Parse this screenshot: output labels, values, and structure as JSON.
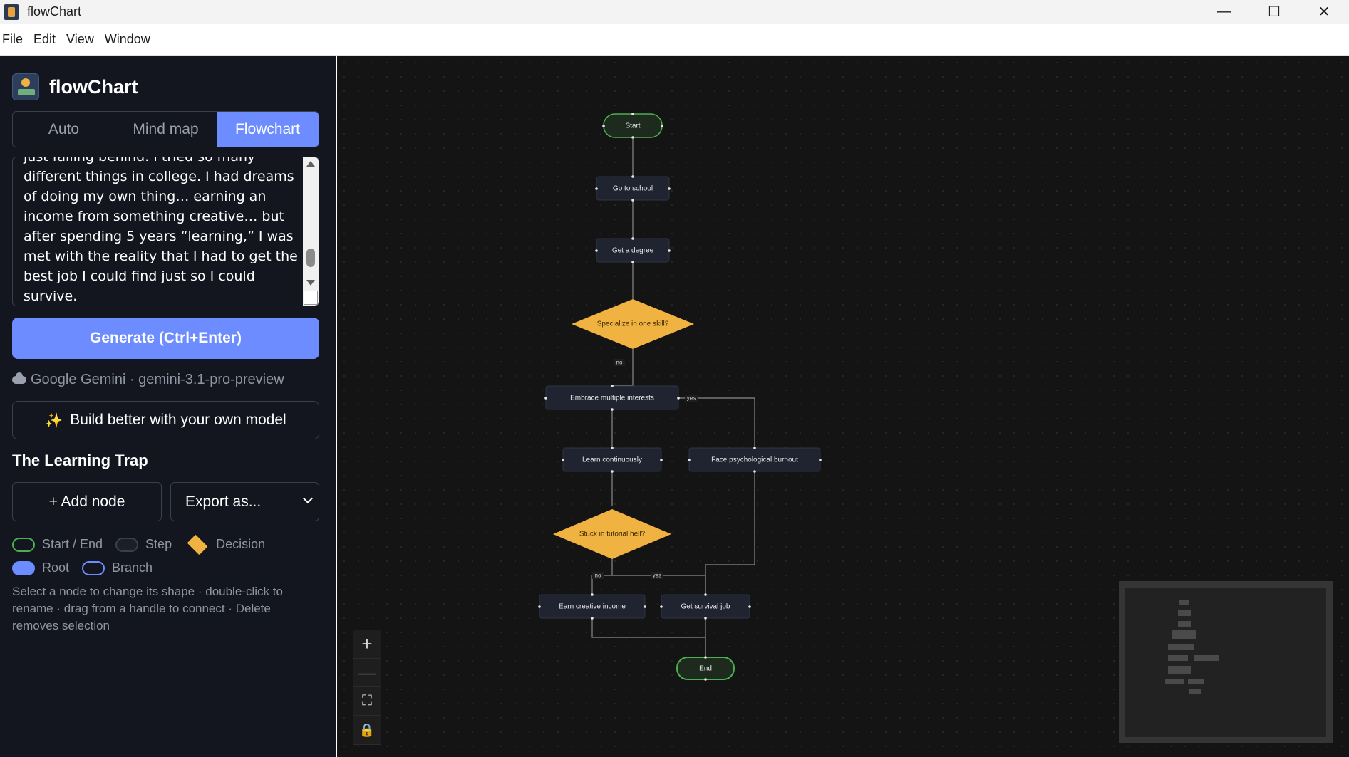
{
  "window": {
    "title": "flowChart",
    "minimize_glyph": "—",
    "maximize_glyph": "☐",
    "close_glyph": "✕"
  },
  "menu": [
    "File",
    "Edit",
    "View",
    "Window"
  ],
  "sidebar": {
    "brand": "flowChart",
    "tabs": [
      {
        "label": "Auto",
        "active": false
      },
      {
        "label": "Mind map",
        "active": false
      },
      {
        "label": "Flowchart",
        "active": true
      }
    ],
    "prompt_text": "just falling behind. I tried so many different things in college. I had dreams of doing my own thing… earning an income from something creative… but after spending 5 years “learning,” I was met with the reality that I had to get the best job I could find just so I could survive.",
    "generate_label": "Generate (Ctrl+Enter)",
    "provider": "Google Gemini · gemini-3.1-pro-preview",
    "build_label": "Build better with your own model",
    "doc_title": "The Learning Trap",
    "add_node_label": "+ Add node",
    "export_label": "Export as...",
    "legend": {
      "start_end": "Start / End",
      "step": "Step",
      "decision": "Decision",
      "root": "Root",
      "branch": "Branch"
    },
    "hint": "Select a node to change its shape · double-click to rename · drag from a handle to connect · Delete removes selection"
  },
  "colors": {
    "accent": "#6c8cff",
    "decision": "#f0b240",
    "start_end_border": "#4caf50",
    "canvas_bg": "#141414",
    "sidebar_bg": "#13161f"
  },
  "flowchart": {
    "nodes": [
      {
        "id": "start",
        "label": "Start",
        "shape": "start-end"
      },
      {
        "id": "school",
        "label": "Go to school",
        "shape": "step"
      },
      {
        "id": "degree",
        "label": "Get a degree",
        "shape": "step"
      },
      {
        "id": "specialize",
        "label": "Specialize in one skill?",
        "shape": "decision"
      },
      {
        "id": "embrace",
        "label": "Embrace multiple interests",
        "shape": "step"
      },
      {
        "id": "learn",
        "label": "Learn continuously",
        "shape": "step"
      },
      {
        "id": "burnout",
        "label": "Face psychological burnout",
        "shape": "step"
      },
      {
        "id": "tutorial",
        "label": "Stuck in tutorial hell?",
        "shape": "decision"
      },
      {
        "id": "creative",
        "label": "Earn creative income",
        "shape": "step"
      },
      {
        "id": "survival",
        "label": "Get survival job",
        "shape": "step"
      },
      {
        "id": "end",
        "label": "End",
        "shape": "start-end"
      }
    ],
    "edge_labels": {
      "specialize_no": "no",
      "embrace_yes": "yes",
      "tutorial_no": "no",
      "tutorial_yes": "yes"
    }
  },
  "canvas_controls": [
    "zoom-in",
    "zoom-out",
    "fit-view",
    "lock"
  ]
}
